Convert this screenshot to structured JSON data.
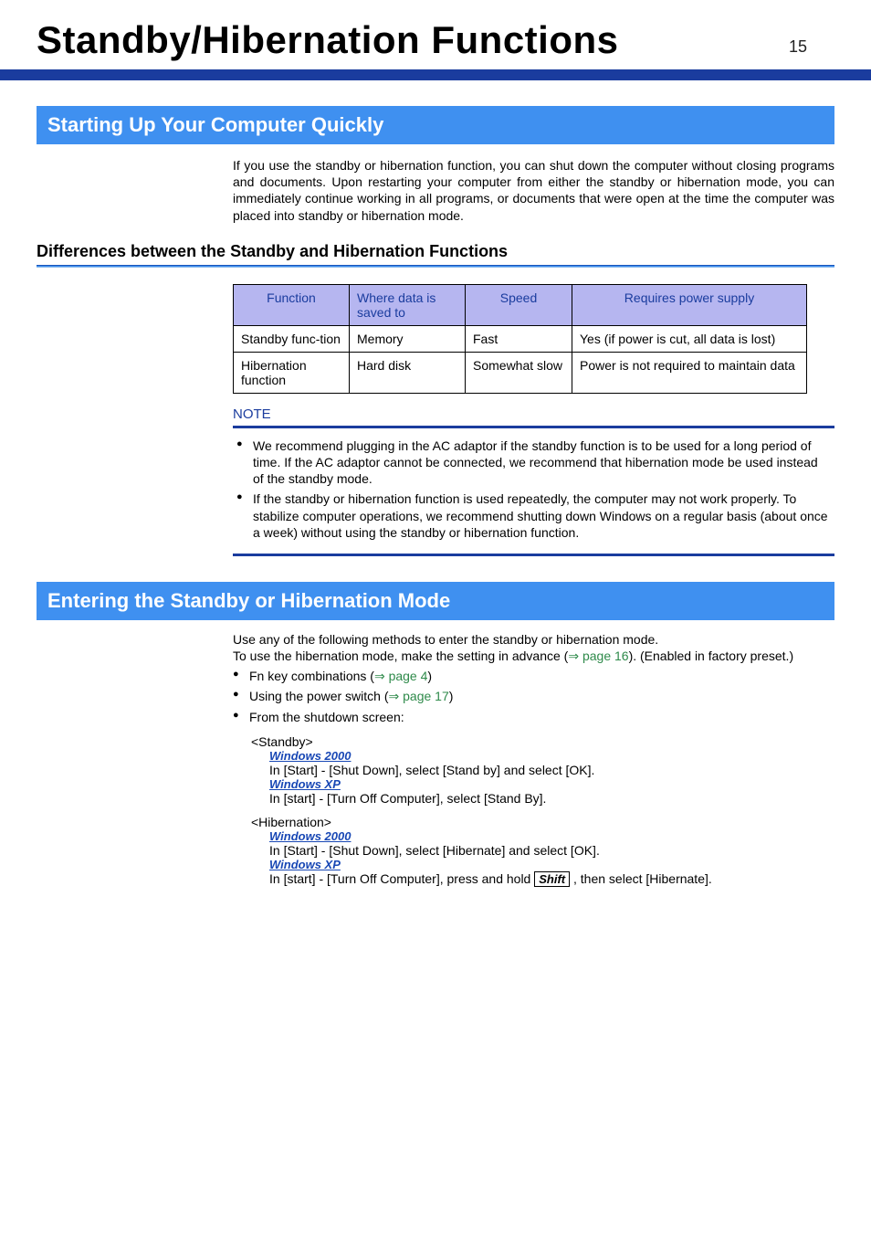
{
  "page": {
    "title": "Standby/Hibernation Functions",
    "number": "15"
  },
  "section1": {
    "header": "Starting Up Your Computer Quickly",
    "intro": "If you use the standby or hibernation function, you can shut down the computer without closing programs and documents. Upon restarting your computer from either the standby or hibernation mode, you can immediately continue working in all programs, or documents that were open at the time the computer was placed into standby or hibernation mode.",
    "sub_header": "Differences between the Standby and Hibernation Functions",
    "table": {
      "headers": [
        "Function",
        "Where data is saved to",
        "Speed",
        "Requires power supply"
      ],
      "rows": [
        {
          "c1": "Standby func-tion",
          "c2": "Memory",
          "c3": "Fast",
          "c4": "Yes (if power is cut, all data is lost)"
        },
        {
          "c1": "Hibernation function",
          "c2": "Hard disk",
          "c3": "Somewhat slow",
          "c4": "Power is not required to maintain data"
        }
      ]
    },
    "note_label": "NOTE",
    "note_bullets": [
      "We recommend plugging in the AC adaptor if the standby function is to be used for a long period of time. If the AC adaptor cannot be connected, we recommend that hibernation mode be used instead of the standby mode.",
      "If the standby or hibernation function is used repeatedly, the computer may not work properly. To stabilize computer operations, we recommend shutting down Windows on a regular basis (about once a week) without using the standby or hibernation function."
    ]
  },
  "section2": {
    "header": "Entering the Standby or Hibernation Mode",
    "intro1": "Use any of the following methods to enter the standby or hibernation mode.",
    "intro2a": "To use the hibernation mode, make the setting in advance (",
    "intro2_link": "page 16",
    "intro2b": "). (Enabled in factory preset.)",
    "bullets": {
      "b1a": "Fn key combinations (",
      "b1_link": "page 4",
      "b1b": ")",
      "b2a": "Using the power switch (",
      "b2_link": "page 17",
      "b2b": ")",
      "b3": "From the shutdown screen:"
    },
    "standby_label": "<Standby>",
    "win2000": "Windows 2000",
    "standby_win2000": "In [Start] - [Shut Down], select [Stand by] and select [OK].",
    "winxp": "Windows XP",
    "standby_winxp": "In [start] - [Turn Off Computer], select [Stand By].",
    "hib_label": "<Hibernation>",
    "hib_win2000": "In [Start] - [Shut Down], select [Hibernate] and select [OK].",
    "hib_winxp_a": "In [start] - [Turn Off Computer], press and hold ",
    "hib_winxp_key": "Shift",
    "hib_winxp_b": " , then select [Hibernate]."
  }
}
